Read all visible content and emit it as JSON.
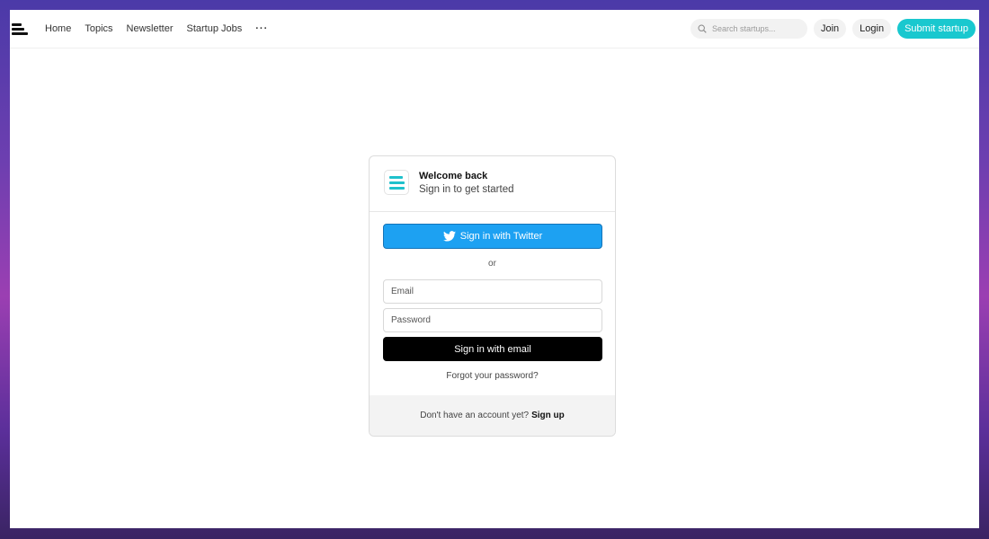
{
  "nav": {
    "items": [
      "Home",
      "Topics",
      "Newsletter",
      "Startup Jobs"
    ],
    "more": "···"
  },
  "header": {
    "search_placeholder": "Search startups...",
    "join": "Join",
    "login": "Login",
    "submit": "Submit startup"
  },
  "card": {
    "title": "Welcome back",
    "subtitle": "Sign in to get started",
    "twitter_button": "Sign in with Twitter",
    "or": "or",
    "email_placeholder": "Email",
    "password_placeholder": "Password",
    "email_button": "Sign in with email",
    "forgot": "Forgot your password?",
    "footer_text": "Don't have an account yet?",
    "footer_link": "Sign up"
  },
  "colors": {
    "accent": "#19c8cf",
    "twitter": "#1da1f2",
    "primary_button": "#000000"
  },
  "icons": [
    "menu-logo-icon",
    "search-icon",
    "twitter-icon",
    "brand-logo-icon"
  ]
}
